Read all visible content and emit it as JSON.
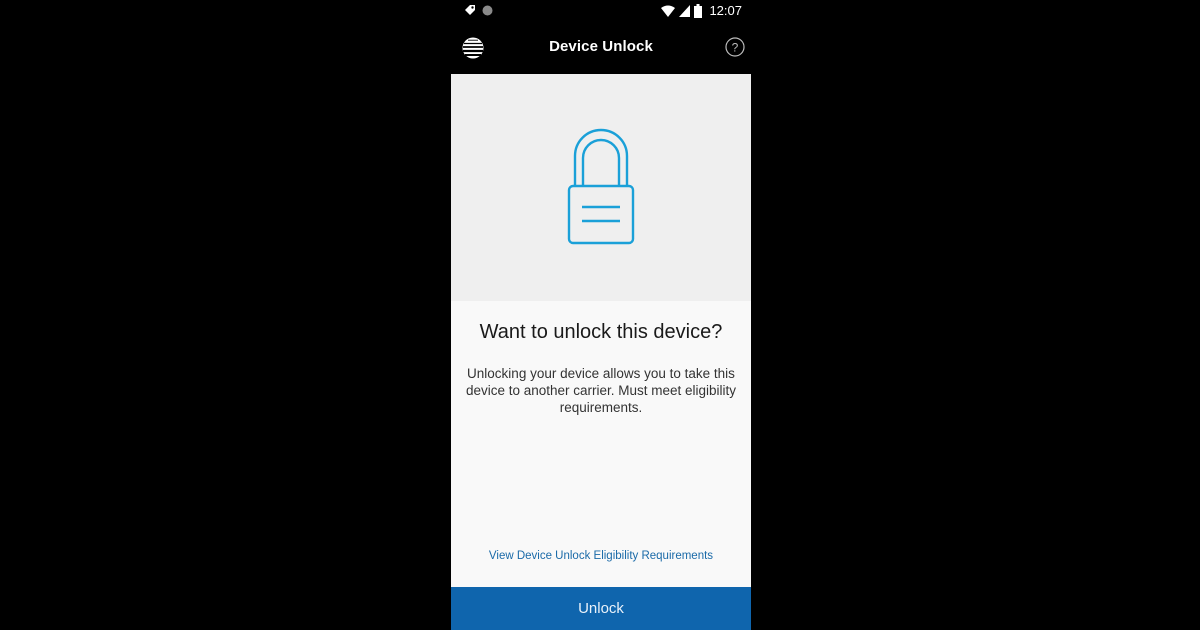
{
  "status_bar": {
    "time": "12:07",
    "icons": [
      "notification-tag-icon",
      "circle-status-icon",
      "wifi-icon",
      "signal-icon",
      "battery-icon"
    ]
  },
  "app_bar": {
    "title": "Device Unlock",
    "logo_icon": "att-globe-icon",
    "help_icon": "help-circle-icon"
  },
  "hero": {
    "icon": "padlock-icon",
    "accent_color": "#1aa0d8"
  },
  "main": {
    "headline": "Want to unlock this device?",
    "description": "Unlocking your device allows you to take this device to another carrier. Must meet eligibility requirements.",
    "link_label": "View Device Unlock Eligibility Requirements"
  },
  "footer": {
    "unlock_label": "Unlock",
    "button_color": "#0f65ad"
  }
}
